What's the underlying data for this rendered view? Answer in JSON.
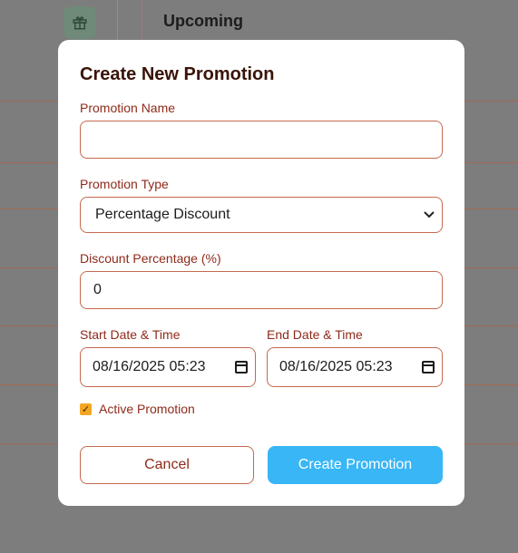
{
  "background": {
    "heading": "Upcoming",
    "gift_icon": "gift-icon"
  },
  "modal": {
    "title": "Create New Promotion",
    "name_label": "Promotion Name",
    "name_value": "",
    "type_label": "Promotion Type",
    "type_value": "Percentage Discount",
    "discount_label": "Discount Percentage (%)",
    "discount_value": "0",
    "start_label": "Start Date & Time",
    "start_value": "08/16/2025 05:23",
    "end_label": "End Date & Time",
    "end_value": "08/16/2025 05:23",
    "active_label": "Active Promotion",
    "active_checked": true,
    "cancel_label": "Cancel",
    "submit_label": "Create Promotion"
  },
  "colors": {
    "accent": "#38b6f5",
    "border": "#c46a4e",
    "label": "#8f2a1a",
    "checkbox": "#f4a623"
  }
}
